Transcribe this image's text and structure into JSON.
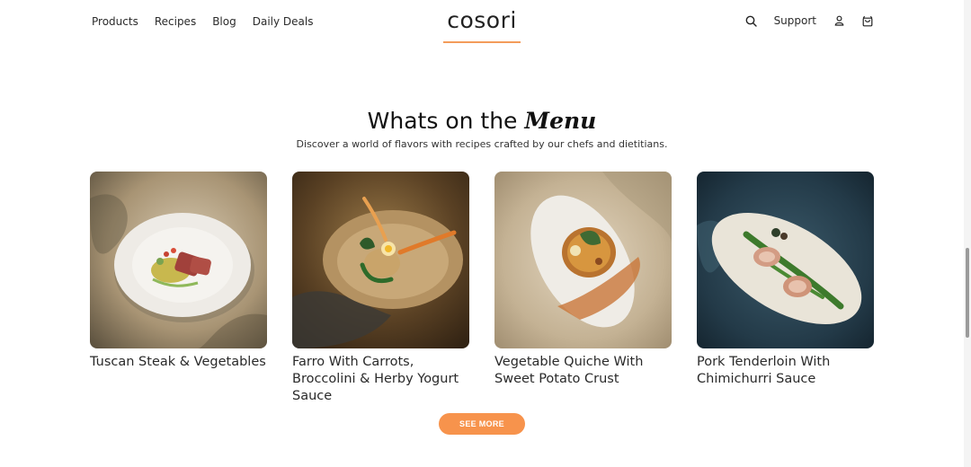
{
  "nav": {
    "left": [
      "Products",
      "Recipes",
      "Blog",
      "Daily Deals"
    ],
    "logo": "cosori",
    "support": "Support"
  },
  "icons": {
    "search": "search-icon",
    "account": "user-icon",
    "cart": "cart-icon"
  },
  "section": {
    "title_main": "Whats on the",
    "title_accent": "Menu",
    "subtitle": "Discover a world of flavors with recipes crafted by our chefs and dietitians."
  },
  "recipes": [
    {
      "title": "Tuscan Steak & Vegetables"
    },
    {
      "title": "Farro With Carrots, Broccolini & Herby Yogurt Sauce"
    },
    {
      "title": "Vegetable Quiche With Sweet Potato Crust"
    },
    {
      "title": "Pork Tenderloin With Chimichurri Sauce"
    }
  ],
  "button": {
    "see_more": "SEE MORE"
  },
  "colors": {
    "accent": "#f7934c",
    "logo_underline": "#f39c5a"
  }
}
